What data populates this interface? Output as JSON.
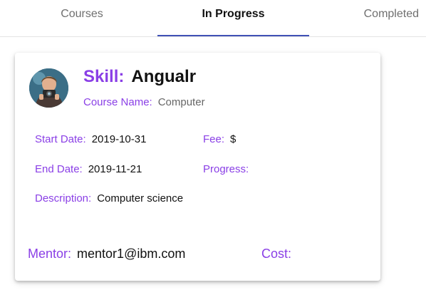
{
  "tabs": [
    {
      "label": "Courses"
    },
    {
      "label": "In Progress"
    },
    {
      "label": "Completed"
    }
  ],
  "active_tab_color": "#3f51b5",
  "accent_color": "#8a3fe6",
  "card": {
    "avatar_icon": "person-with-camera-avatar",
    "skill_label": "Skill:",
    "skill_value": "Angualr",
    "course_name_label": "Course Name:",
    "course_name_value": "Computer",
    "start_date_label": "Start Date:",
    "start_date_value": "2019-10-31",
    "fee_label": "Fee:",
    "fee_value": "$",
    "end_date_label": "End Date:",
    "end_date_value": "2019-11-21",
    "progress_label": "Progress:",
    "progress_value": "",
    "description_label": "Description:",
    "description_value": "Computer science",
    "mentor_label": "Mentor:",
    "mentor_value": "mentor1@ibm.com",
    "cost_label": "Cost:",
    "cost_value": ""
  }
}
